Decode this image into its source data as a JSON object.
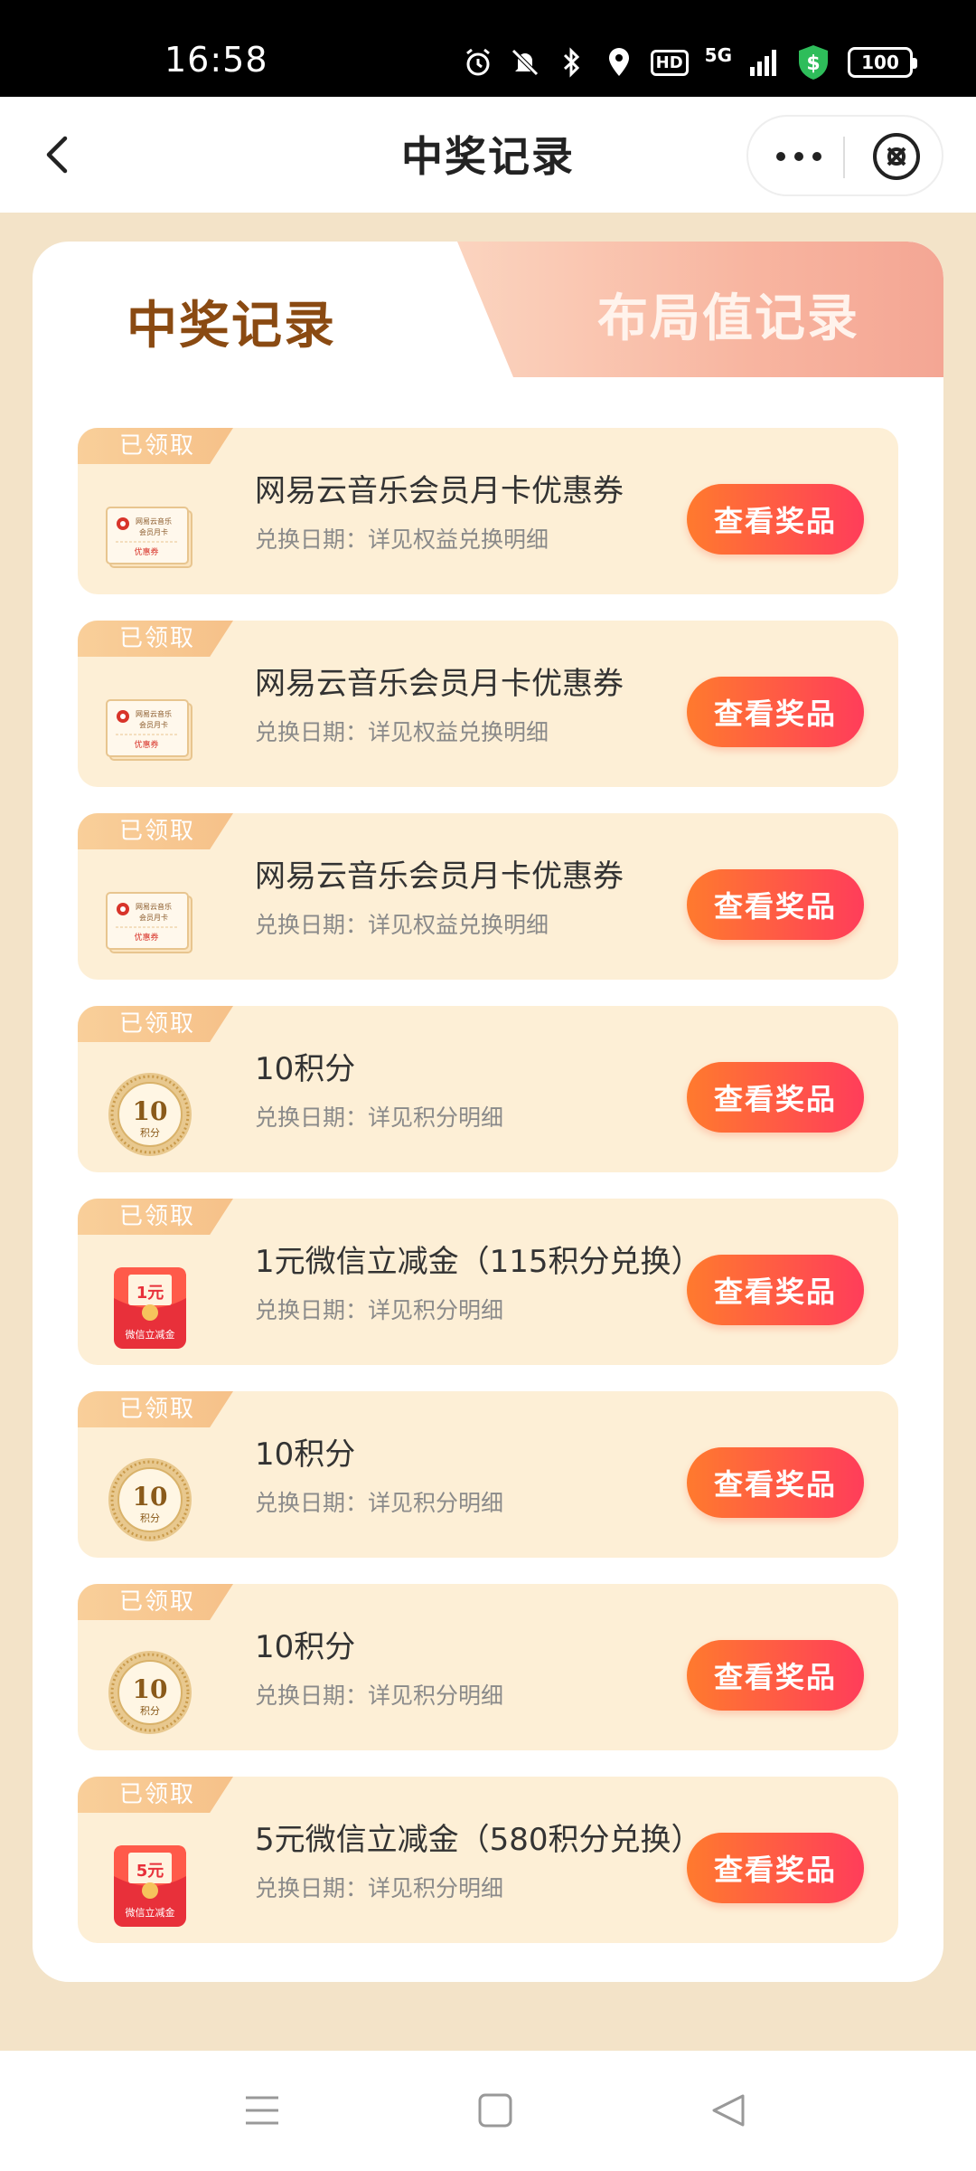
{
  "status_bar": {
    "time": "16:58",
    "network": "5G",
    "hd": "HD",
    "battery": "100"
  },
  "nav": {
    "title": "中奖记录"
  },
  "tabs": [
    {
      "label": "中奖记录",
      "active": true
    },
    {
      "label": "布局值记录",
      "active": false
    }
  ],
  "records": [
    {
      "badge": "已领取",
      "title": "网易云音乐会员月卡优惠券",
      "subtitle": "兑换日期：详见权益兑换明细",
      "button": "查看奖品",
      "thumb": "coupon",
      "thumb_line1": "网易云音乐",
      "thumb_line2": "会员月卡",
      "thumb_line3": "优惠券"
    },
    {
      "badge": "已领取",
      "title": "网易云音乐会员月卡优惠券",
      "subtitle": "兑换日期：详见权益兑换明细",
      "button": "查看奖品",
      "thumb": "coupon",
      "thumb_line1": "网易云音乐",
      "thumb_line2": "会员月卡",
      "thumb_line3": "优惠券"
    },
    {
      "badge": "已领取",
      "title": "网易云音乐会员月卡优惠券",
      "subtitle": "兑换日期：详见权益兑换明细",
      "button": "查看奖品",
      "thumb": "coupon",
      "thumb_line1": "网易云音乐",
      "thumb_line2": "会员月卡",
      "thumb_line3": "优惠券"
    },
    {
      "badge": "已领取",
      "title": "10积分",
      "subtitle": "兑换日期：详见积分明细",
      "button": "查看奖品",
      "thumb": "points",
      "thumb_value": "10",
      "thumb_unit": "积分"
    },
    {
      "badge": "已领取",
      "title": "1元微信立减金（115积分兑换）",
      "subtitle": "兑换日期：详见积分明细",
      "button": "查看奖品",
      "thumb": "redpacket",
      "thumb_value": "1元",
      "thumb_label": "微信立减金"
    },
    {
      "badge": "已领取",
      "title": "10积分",
      "subtitle": "兑换日期：详见积分明细",
      "button": "查看奖品",
      "thumb": "points",
      "thumb_value": "10",
      "thumb_unit": "积分"
    },
    {
      "badge": "已领取",
      "title": "10积分",
      "subtitle": "兑换日期：详见积分明细",
      "button": "查看奖品",
      "thumb": "points",
      "thumb_value": "10",
      "thumb_unit": "积分"
    },
    {
      "badge": "已领取",
      "title": "5元微信立减金（580积分兑换）",
      "subtitle": "兑换日期：详见积分明细",
      "button": "查看奖品",
      "thumb": "redpacket",
      "thumb_value": "5元",
      "thumb_label": "微信立减金"
    }
  ],
  "colors": {
    "accent_start": "#ff7a2e",
    "accent_end": "#ff3d5a",
    "card_bg": "#fdefd6",
    "page_bg": "#f3e3c8",
    "active_tab": "#8a4a12"
  }
}
